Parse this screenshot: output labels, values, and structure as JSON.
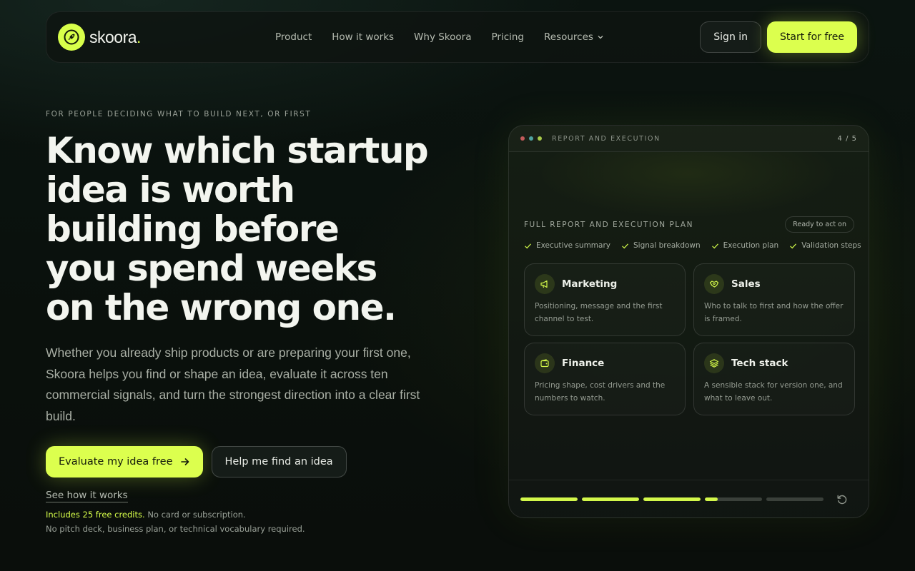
{
  "nav": {
    "logo_text": "skoora",
    "logo_dot": ".",
    "links": [
      "Product",
      "How it works",
      "Why Skoora",
      "Pricing",
      "Resources"
    ],
    "sign_in": "Sign in",
    "start": "Start for free"
  },
  "hero": {
    "eyebrow": "FOR PEOPLE DECIDING WHAT TO BUILD NEXT, OR FIRST",
    "headline": [
      "Know which startup",
      "idea is worth",
      "building before",
      "you spend weeks",
      "on the wrong one."
    ],
    "lead": "Whether you already ship products or are preparing your first one, Skoora helps you find or shape an idea, evaluate it across ten commercial signals, and turn the strongest direction into a clear first build.",
    "cta_primary": "Evaluate my idea free",
    "cta_secondary": "Help me find an idea",
    "see_how": "See how it works",
    "credits_highlight": "Includes 25 free credits.",
    "credits_rest": "No card or subscription.",
    "no_pitch": "No pitch deck, business plan, or technical vocabulary required."
  },
  "card": {
    "header_title": "REPORT AND EXECUTION",
    "step": "4 / 5",
    "dot_colors": [
      "#c25b5b",
      "#4fa3a0",
      "#a8c94a"
    ],
    "report_title": "FULL REPORT AND EXECUTION PLAN",
    "badge": "Ready to act on",
    "checks": [
      "Executive summary",
      "Signal breakdown",
      "Execution plan",
      "Validation steps"
    ],
    "tiles": [
      {
        "name": "Marketing",
        "desc": "Positioning, message and the first channel to test.",
        "icon": "megaphone-icon"
      },
      {
        "name": "Sales",
        "desc": "Who to talk to first and how the offer is framed.",
        "icon": "handshake-icon"
      },
      {
        "name": "Finance",
        "desc": "Pricing shape, cost drivers and the numbers to watch.",
        "icon": "wallet-icon"
      },
      {
        "name": "Tech stack",
        "desc": "A sensible stack for version one, and what to leave out.",
        "icon": "layers-icon"
      }
    ],
    "progress": [
      1,
      1,
      1,
      0.22,
      0
    ]
  },
  "colors": {
    "accent": "#dcff4e",
    "background": "#0a100c"
  }
}
